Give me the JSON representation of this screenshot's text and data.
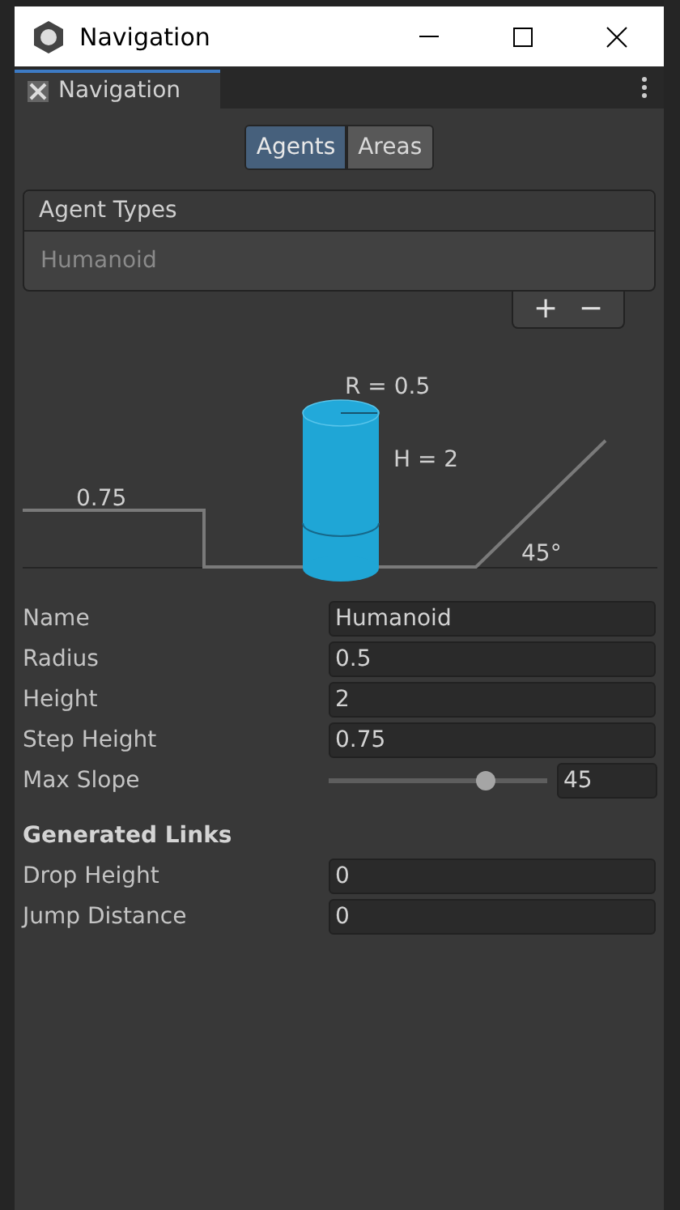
{
  "window": {
    "title": "Navigation"
  },
  "panel_tab": {
    "label": "Navigation"
  },
  "tabs": [
    {
      "label": "Agents",
      "selected": true
    },
    {
      "label": "Areas",
      "selected": false
    }
  ],
  "agent_types": {
    "header": "Agent Types",
    "items": [
      {
        "label": "Humanoid",
        "selected": false
      }
    ],
    "add": "+",
    "remove": "−"
  },
  "diagram": {
    "radius_label": "R = 0.5",
    "height_label": "H = 2",
    "step_label": "0.75",
    "slope_label": "45°"
  },
  "fields": [
    {
      "label": "Name",
      "kind": "text",
      "value": "Humanoid"
    },
    {
      "label": "Radius",
      "kind": "text",
      "value": "0.5"
    },
    {
      "label": "Height",
      "kind": "text",
      "value": "2"
    },
    {
      "label": "Step Height",
      "kind": "text",
      "value": "0.75"
    },
    {
      "label": "Max Slope",
      "kind": "slider",
      "value": "45",
      "level": 0.72
    }
  ],
  "generated_links": {
    "title": "Generated Links",
    "fields": [
      {
        "label": "Drop Height",
        "value": "0"
      },
      {
        "label": "Jump Distance",
        "value": "0"
      }
    ]
  }
}
